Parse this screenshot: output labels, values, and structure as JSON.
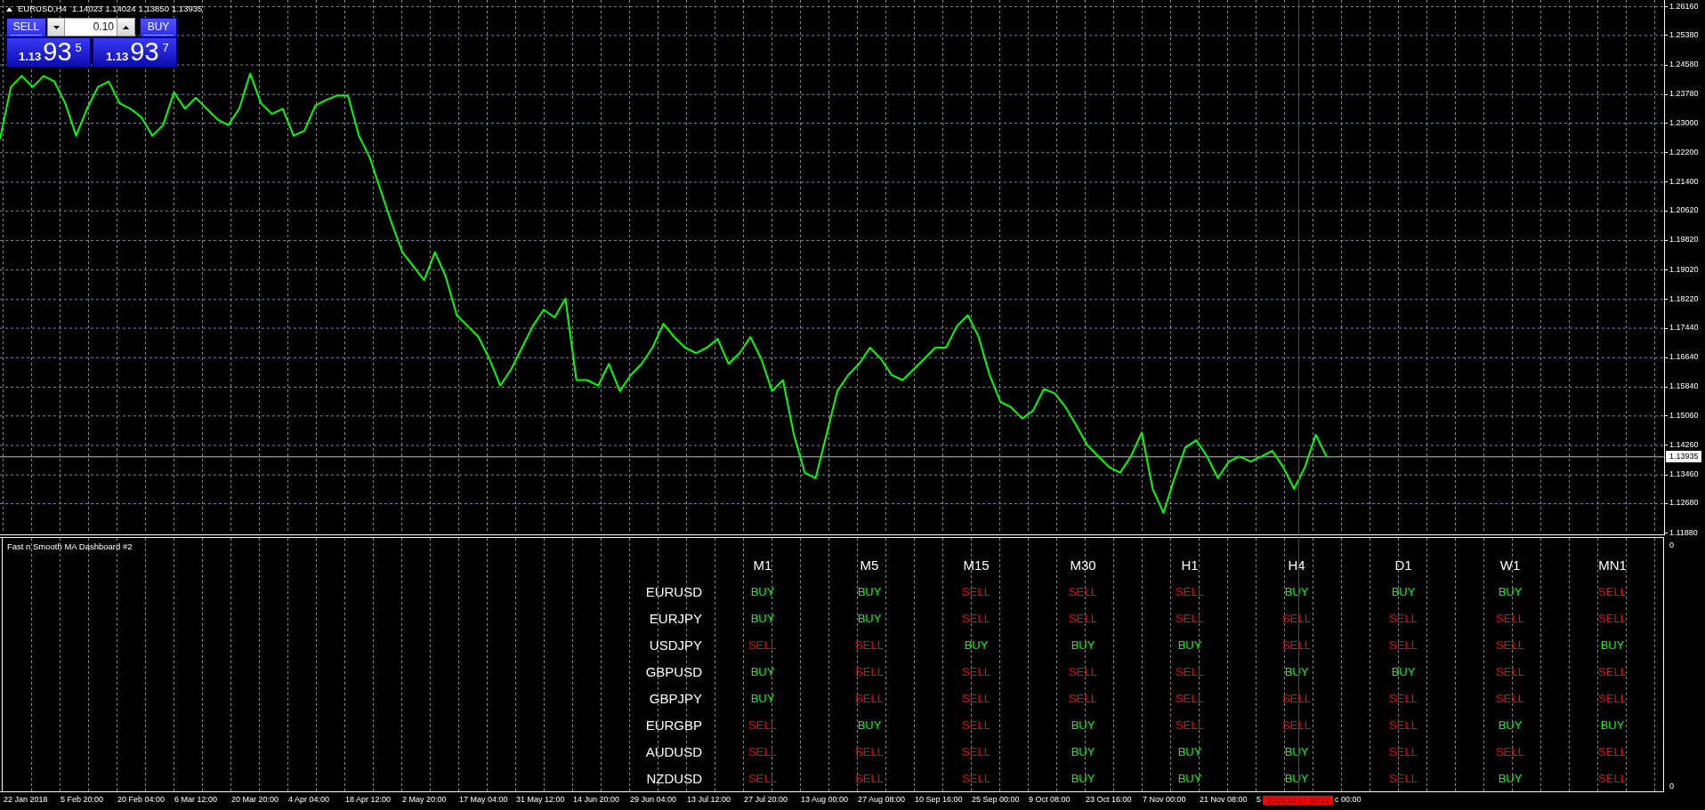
{
  "chart_window": {
    "symbol": "EURUSD,H4",
    "ohlc": [
      "1.14023",
      "1.14024",
      "1.13850",
      "1.13935"
    ]
  },
  "trade_panel": {
    "sell": {
      "label": "SELL",
      "prefix": "1.13",
      "pips": "93",
      "fraction": "5"
    },
    "lot": {
      "value": "0.10"
    },
    "buy": {
      "label": "BUY",
      "prefix": "1.13",
      "pips": "93",
      "fraction": "7"
    }
  },
  "price_chart": {
    "current_price": "1.13935",
    "chart_data": {
      "type": "line",
      "grid": true,
      "series": [
        {
          "color": "#00ff00",
          "values": [
            1.2256,
            1.2397,
            1.2427,
            1.2397,
            1.2427,
            1.2412,
            1.2353,
            1.2265,
            1.2338,
            1.2397,
            1.2412,
            1.2353,
            1.2338,
            1.2315,
            1.2265,
            1.2294,
            1.2383,
            1.2338,
            1.2368,
            1.2338,
            1.2309,
            1.2294,
            1.2338,
            1.2433,
            1.2353,
            1.2324,
            1.2338,
            1.2265,
            1.2279,
            1.2347,
            1.2362,
            1.2374,
            1.2374,
            1.2265,
            1.2206,
            1.2117,
            1.2029,
            1.1949,
            1.1911,
            1.1873,
            1.1949,
            1.1882,
            1.1778,
            1.1749,
            1.1719,
            1.166,
            1.1587,
            1.1631,
            1.169,
            1.1749,
            1.1793,
            1.1772,
            1.1823,
            1.1602,
            1.1602,
            1.1587,
            1.1646,
            1.1572,
            1.1616,
            1.1646,
            1.169,
            1.1755,
            1.1719,
            1.169,
            1.1675,
            1.169,
            1.1714,
            1.1646,
            1.1675,
            1.1719,
            1.166,
            1.1572,
            1.1602,
            1.1454,
            1.1351,
            1.1336,
            1.1454,
            1.1572,
            1.1616,
            1.1646,
            1.169,
            1.166,
            1.1616,
            1.1602,
            1.1631,
            1.166,
            1.169,
            1.169,
            1.1749,
            1.1778,
            1.1719,
            1.1616,
            1.1543,
            1.1528,
            1.1498,
            1.1519,
            1.1578,
            1.1566,
            1.1528,
            1.1478,
            1.1425,
            1.1395,
            1.1366,
            1.1351,
            1.1395,
            1.146,
            1.1307,
            1.1242,
            1.1336,
            1.1419,
            1.1439,
            1.1395,
            1.1336,
            1.1381,
            1.1395,
            1.1381,
            1.1395,
            1.141,
            1.1366,
            1.1307,
            1.1366,
            1.1454,
            1.1394
          ]
        },
        {
          "color": "#b8c4cc",
          "values": [
            1.1394,
            1.1394,
            1.1394,
            1.1394,
            1.1394,
            1.1394,
            1.1394,
            1.1394,
            1.1394,
            1.1394,
            1.1394,
            1.1394,
            1.1394,
            1.1394,
            1.1394,
            1.1394,
            1.1394,
            1.1394,
            1.1394,
            1.1394,
            1.1394,
            1.1394,
            1.1394,
            1.1394,
            1.1394,
            1.1394,
            1.1394,
            1.1394,
            1.1394,
            1.1394,
            1.1394,
            1.1394,
            1.1394,
            1.1394,
            1.1394,
            1.1394,
            1.1394,
            1.1394,
            1.1394,
            1.1394,
            1.1394,
            1.1394,
            1.1394,
            1.1394,
            1.1394,
            1.1394,
            1.1394,
            1.1394,
            1.1394,
            1.1394,
            1.1394,
            1.1394,
            1.1394,
            1.1394,
            1.1394,
            1.1394,
            1.1394,
            1.1394,
            1.1394,
            1.1394,
            1.1394,
            1.1394,
            1.1394,
            1.1394,
            1.1394,
            1.1394,
            1.1394,
            1.1394,
            1.1394,
            1.1394,
            1.1394,
            1.1394,
            1.1394,
            1.1394,
            1.1394,
            1.1394,
            1.1394,
            1.1394,
            1.1394,
            1.1394,
            1.1394,
            1.1394,
            1.1394,
            1.1394,
            1.1394,
            1.1394,
            1.1394,
            1.1394,
            1.1394,
            1.1394,
            1.1394,
            1.1394,
            1.1394,
            1.1394,
            1.1394,
            1.1394,
            1.1394,
            1.1394,
            1.1394,
            1.1394,
            1.1394,
            1.1394,
            1.1394,
            1.1394,
            1.1394,
            1.1394,
            1.1394,
            1.1394,
            1.1394,
            1.1394,
            1.1394,
            1.1394,
            1.1394,
            1.1394,
            1.1394,
            1.1394,
            1.1394,
            1.1394,
            1.1394,
            1.1394,
            1.1394,
            1.1394,
            1.1394,
            1.1394,
            1.1394,
            1.1394,
            1.1394,
            1.1394,
            1.1394,
            1.1394,
            1.1394,
            1.1394,
            1.1394,
            1.1394,
            1.1394,
            1.1394,
            1.1394,
            1.1394,
            1.1394,
            1.1394,
            1.1394,
            1.1394,
            1.1394,
            1.1394,
            1.1394,
            1.1394,
            1.1394,
            1.1394,
            1.1394,
            1.1394,
            1.1394,
            1.1394,
            1.1394,
            1.1394
          ]
        }
      ],
      "ylim": [
        1.1186,
        1.2633
      ],
      "yticks": [
        {
          "value": 1.2616,
          "label": "1.26160"
        },
        {
          "value": 1.2538,
          "label": "1.25380"
        },
        {
          "value": 1.2458,
          "label": "1.24580"
        },
        {
          "value": 1.2378,
          "label": "1.23780"
        },
        {
          "value": 1.23,
          "label": "1.23000"
        },
        {
          "value": 1.222,
          "label": "1.22200"
        },
        {
          "value": 1.214,
          "label": "1.21400"
        },
        {
          "value": 1.2062,
          "label": "1.20620"
        },
        {
          "value": 1.1982,
          "label": "1.19820"
        },
        {
          "value": 1.1902,
          "label": "1.19020"
        },
        {
          "value": 1.1822,
          "label": "1.18220"
        },
        {
          "value": 1.1744,
          "label": "1.17440"
        },
        {
          "value": 1.1664,
          "label": "1.16640"
        },
        {
          "value": 1.1584,
          "label": "1.15840"
        },
        {
          "value": 1.1506,
          "label": "1.15060"
        },
        {
          "value": 1.1426,
          "label": "1.14260"
        },
        {
          "value": 1.1346,
          "label": "1.13460"
        },
        {
          "value": 1.1268,
          "label": "1.12680"
        },
        {
          "value": 1.1188,
          "label": "1.11880"
        }
      ]
    }
  },
  "time_axis": {
    "labels": [
      "22 Jan 2018",
      "5 Feb 20:00",
      "20 Feb 04:00",
      "6 Mar 12:00",
      "20 Mar 20:00",
      "4 Apr 04:00",
      "18 Apr 12:00",
      "2 May 20:00",
      "17 May 04:00",
      "31 May 12:00",
      "14 Jun 20:00",
      "29 Jun 04:00",
      "13 Jul 12:00",
      "27 Jul 20:00",
      "13 Aug 00:00",
      "27 Aug 08:00",
      "10 Sep 16:00",
      "25 Sep 00:00",
      "9 Oct 08:00",
      "23 Oct 16:00",
      "7 Nov 00:00",
      "21 Nov 08:00",
      "5"
    ]
  },
  "time_marker": {
    "label": "2018.12.17 08:12",
    "tail_text": "c 00:00"
  },
  "indicator": {
    "title": "Fast n Smooth MA Dashboard #2",
    "scale_labels": [
      "0",
      "0"
    ],
    "columns": [
      "M1",
      "M5",
      "M15",
      "M30",
      "H1",
      "H4",
      "D1",
      "W1",
      "MN1"
    ],
    "rows": [
      {
        "symbol": "EURUSD",
        "signals": [
          {
            "text": "BUY",
            "color": "#00ff00"
          },
          {
            "text": "BUY",
            "color": "#00ff00"
          },
          {
            "text": "SELL",
            "color": "#ff0000"
          },
          {
            "text": "SELL",
            "color": "#ff0000"
          },
          {
            "text": "SELL",
            "color": "#ff0000"
          },
          {
            "text": "BUY",
            "color": "#00ff00"
          },
          {
            "text": "BUY",
            "color": "#00ff00"
          },
          {
            "text": "BUY",
            "color": "#00ff00"
          },
          {
            "text": "SELL",
            "color": "#ff0000"
          }
        ]
      },
      {
        "symbol": "EURJPY",
        "signals": [
          {
            "text": "BUY",
            "color": "#00ff00"
          },
          {
            "text": "BUY",
            "color": "#00ff00"
          },
          {
            "text": "SELL",
            "color": "#ff0000"
          },
          {
            "text": "SELL",
            "color": "#ff0000"
          },
          {
            "text": "SELL",
            "color": "#ff0000"
          },
          {
            "text": "SELL",
            "color": "#ff0000"
          },
          {
            "text": "SELL",
            "color": "#ff0000"
          },
          {
            "text": "SELL",
            "color": "#ff0000"
          },
          {
            "text": "SELL",
            "color": "#ff0000"
          }
        ]
      },
      {
        "symbol": "USDJPY",
        "signals": [
          {
            "text": "SELL",
            "color": "#ff0000"
          },
          {
            "text": "SELL",
            "color": "#ff0000"
          },
          {
            "text": "BUY",
            "color": "#00ff00"
          },
          {
            "text": "BUY",
            "color": "#00ff00"
          },
          {
            "text": "BUY",
            "color": "#00ff00"
          },
          {
            "text": "SELL",
            "color": "#ff0000"
          },
          {
            "text": "SELL",
            "color": "#ff0000"
          },
          {
            "text": "SELL",
            "color": "#ff0000"
          },
          {
            "text": "BUY",
            "color": "#00ff00"
          }
        ]
      },
      {
        "symbol": "GBPUSD",
        "signals": [
          {
            "text": "BUY",
            "color": "#00ff00"
          },
          {
            "text": "SELL",
            "color": "#ff0000"
          },
          {
            "text": "SELL",
            "color": "#ff0000"
          },
          {
            "text": "SELL",
            "color": "#ff0000"
          },
          {
            "text": "SELL",
            "color": "#ff0000"
          },
          {
            "text": "BUY",
            "color": "#00ff00"
          },
          {
            "text": "BUY",
            "color": "#00ff00"
          },
          {
            "text": "SELL",
            "color": "#ff0000"
          },
          {
            "text": "SELL",
            "color": "#ff0000"
          }
        ]
      },
      {
        "symbol": "GBPJPY",
        "signals": [
          {
            "text": "BUY",
            "color": "#00ff00"
          },
          {
            "text": "SELL",
            "color": "#ff0000"
          },
          {
            "text": "SELL",
            "color": "#ff0000"
          },
          {
            "text": "SELL",
            "color": "#ff0000"
          },
          {
            "text": "SELL",
            "color": "#ff0000"
          },
          {
            "text": "SELL",
            "color": "#ff0000"
          },
          {
            "text": "SELL",
            "color": "#ff0000"
          },
          {
            "text": "SELL",
            "color": "#ff0000"
          },
          {
            "text": "SELL",
            "color": "#ff0000"
          }
        ]
      },
      {
        "symbol": "EURGBP",
        "signals": [
          {
            "text": "SELL",
            "color": "#ff0000"
          },
          {
            "text": "BUY",
            "color": "#00ff00"
          },
          {
            "text": "SELL",
            "color": "#ff0000"
          },
          {
            "text": "BUY",
            "color": "#00ff00"
          },
          {
            "text": "SELL",
            "color": "#ff0000"
          },
          {
            "text": "SELL",
            "color": "#ff0000"
          },
          {
            "text": "SELL",
            "color": "#ff0000"
          },
          {
            "text": "BUY",
            "color": "#00ff00"
          },
          {
            "text": "BUY",
            "color": "#00ff00"
          }
        ]
      },
      {
        "symbol": "AUDUSD",
        "signals": [
          {
            "text": "SELL",
            "color": "#ff0000"
          },
          {
            "text": "SELL",
            "color": "#ff0000"
          },
          {
            "text": "SELL",
            "color": "#ff0000"
          },
          {
            "text": "BUY",
            "color": "#00ff00"
          },
          {
            "text": "BUY",
            "color": "#00ff00"
          },
          {
            "text": "BUY",
            "color": "#00ff00"
          },
          {
            "text": "SELL",
            "color": "#ff0000"
          },
          {
            "text": "SELL",
            "color": "#ff0000"
          },
          {
            "text": "SELL",
            "color": "#ff0000"
          }
        ]
      },
      {
        "symbol": "NZDUSD",
        "signals": [
          {
            "text": "SELL",
            "color": "#ff0000"
          },
          {
            "text": "SELL",
            "color": "#ff0000"
          },
          {
            "text": "SELL",
            "color": "#ff0000"
          },
          {
            "text": "BUY",
            "color": "#00ff00"
          },
          {
            "text": "BUY",
            "color": "#00ff00"
          },
          {
            "text": "BUY",
            "color": "#00ff00"
          },
          {
            "text": "SELL",
            "color": "#ff0000"
          },
          {
            "text": "BUY",
            "color": "#00ff00"
          },
          {
            "text": "SELL",
            "color": "#ff0000"
          }
        ]
      }
    ]
  }
}
